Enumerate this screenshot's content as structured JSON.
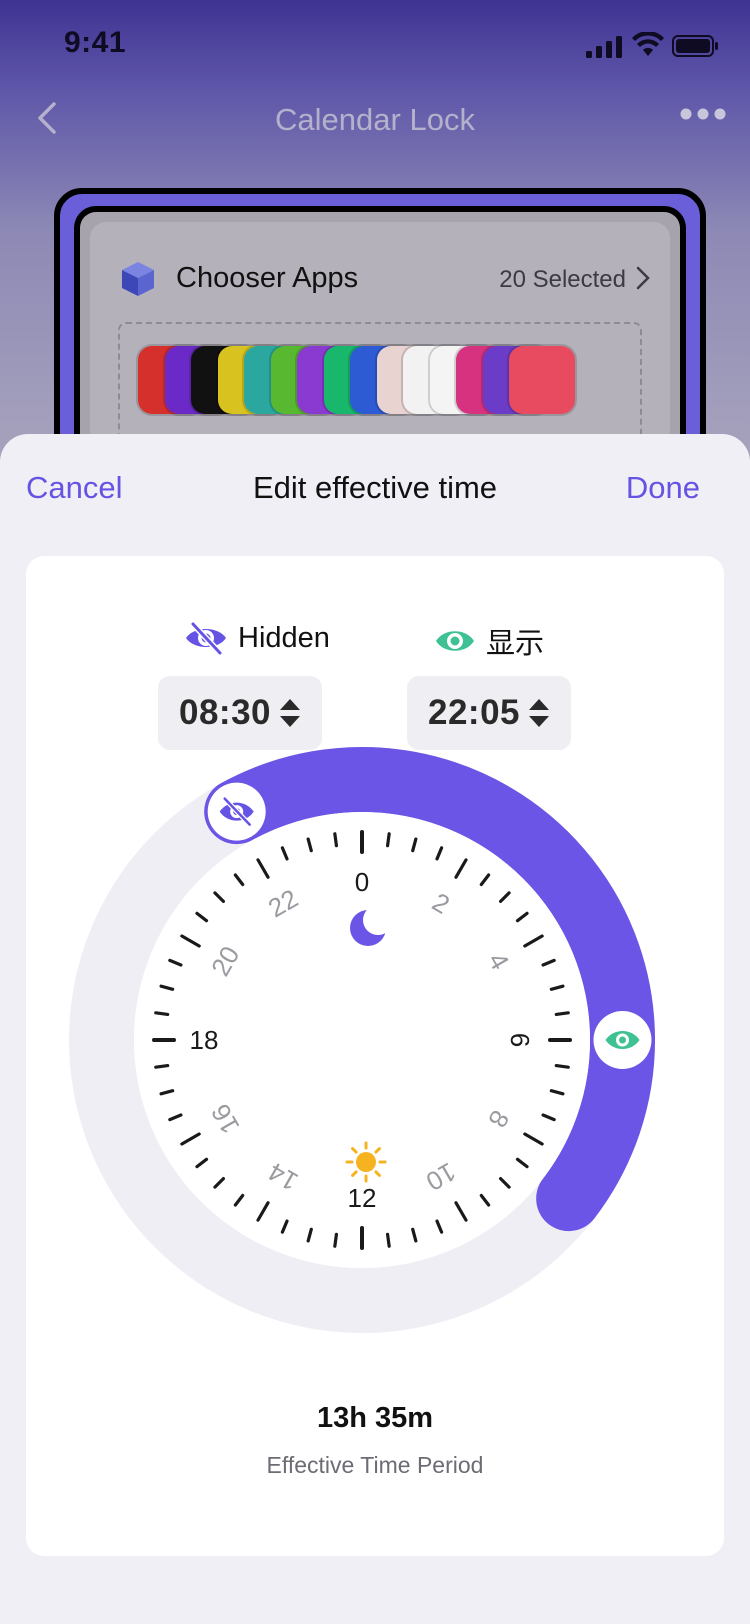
{
  "status_bar": {
    "time": "9:41"
  },
  "nav": {
    "title": "Calendar Lock"
  },
  "chooser": {
    "title": "Chooser Apps",
    "selected": "20 Selected"
  },
  "apps": [
    {
      "name": "tinder-like-app",
      "color": "#d6302c"
    },
    {
      "name": "coffee-app",
      "color": "#6b2ac8"
    },
    {
      "name": "tiktok-app",
      "color": "#111111"
    },
    {
      "name": "yellow-app",
      "color": "#d8c21f"
    },
    {
      "name": "ghost-app",
      "color": "#2aa8a0"
    },
    {
      "name": "green-app",
      "color": "#58b82f"
    },
    {
      "name": "purple-app",
      "color": "#8b3ad1"
    },
    {
      "name": "chat-app",
      "color": "#19b76c"
    },
    {
      "name": "signal-app",
      "color": "#2d5bd3"
    },
    {
      "name": "avatar-app",
      "color": "#e9d3d0"
    },
    {
      "name": "penguin-app",
      "color": "#f2f2f2"
    },
    {
      "name": "gmail-app",
      "color": "#f4f4f4"
    },
    {
      "name": "instagram-app",
      "color": "#d63280"
    },
    {
      "name": "twitch-app",
      "color": "#6b3cc8"
    },
    {
      "name": "flame-app",
      "color": "#e84a5f"
    }
  ],
  "sheet": {
    "cancel_label": "Cancel",
    "title": "Edit effective time",
    "done_label": "Done"
  },
  "hidden": {
    "label": "Hidden",
    "time": "08:30",
    "icon": "eye-slash-icon",
    "color": "#6554e3"
  },
  "show": {
    "label": "显示",
    "time": "22:05",
    "icon": "eye-icon",
    "color": "#3ec293"
  },
  "dial": {
    "hour_labels": [
      "0",
      "2",
      "4",
      "6",
      "8",
      "10",
      "12",
      "14",
      "16",
      "18",
      "20",
      "22"
    ],
    "arc_color": "#6a55e6",
    "track_color": "#efeef5",
    "start_hour": 22.083,
    "end_hour": 8.5,
    "top_icon": "moon-icon",
    "bottom_icon": "sun-icon"
  },
  "summary": {
    "duration": "13h 35m",
    "label": "Effective Time Period"
  }
}
